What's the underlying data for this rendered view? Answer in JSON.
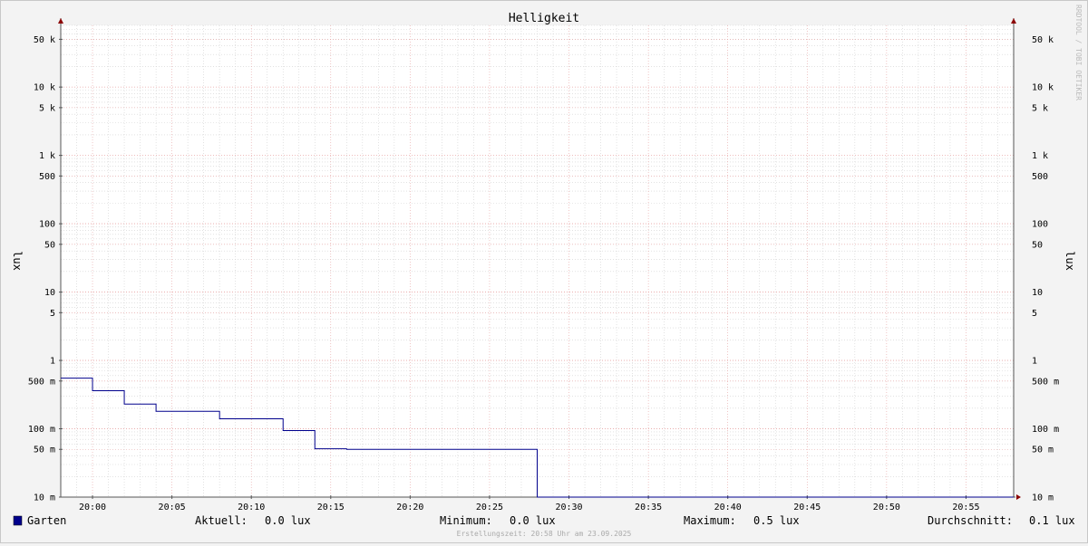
{
  "chart_data": {
    "type": "line",
    "title": "Helligkeit",
    "ylabel_left": "lux",
    "ylabel_right": "lux",
    "y_scale": "log",
    "ylim": [
      0.01,
      80000
    ],
    "y_ticks": [
      {
        "value": 50000,
        "label": "50 k"
      },
      {
        "value": 10000,
        "label": "10 k"
      },
      {
        "value": 5000,
        "label": "5 k"
      },
      {
        "value": 1000,
        "label": "1 k"
      },
      {
        "value": 500,
        "label": "500"
      },
      {
        "value": 100,
        "label": "100"
      },
      {
        "value": 50,
        "label": "50"
      },
      {
        "value": 10,
        "label": "10"
      },
      {
        "value": 5,
        "label": "5"
      },
      {
        "value": 1,
        "label": "1"
      },
      {
        "value": 0.5,
        "label": "500 m"
      },
      {
        "value": 0.1,
        "label": "100 m"
      },
      {
        "value": 0.05,
        "label": "50 m"
      },
      {
        "value": 0.01,
        "label": "10 m"
      }
    ],
    "x_range": [
      "19:58",
      "20:58"
    ],
    "x_ticks": [
      "20:00",
      "20:05",
      "20:10",
      "20:15",
      "20:20",
      "20:25",
      "20:30",
      "20:35",
      "20:40",
      "20:45",
      "20:50",
      "20:55"
    ],
    "series": [
      {
        "name": "Garten",
        "color": "#00008c",
        "points": [
          {
            "t": "19:58",
            "v": 0.55
          },
          {
            "t": "20:00",
            "v": 0.36
          },
          {
            "t": "20:02",
            "v": 0.23
          },
          {
            "t": "20:04",
            "v": 0.18
          },
          {
            "t": "20:08",
            "v": 0.14
          },
          {
            "t": "20:12",
            "v": 0.094
          },
          {
            "t": "20:14",
            "v": 0.051
          },
          {
            "t": "20:16",
            "v": 0.05
          },
          {
            "t": "20:28",
            "v": 0.01
          },
          {
            "t": "20:58",
            "v": 0.01
          }
        ]
      }
    ],
    "grid": true
  },
  "legend": {
    "series_name": "Garten",
    "series_color": "#00008c",
    "aktuell_label": "Aktuell:",
    "aktuell_value": "0.0 lux",
    "minimum_label": "Minimum:",
    "minimum_value": "0.0 lux",
    "maximum_label": "Maximum:",
    "maximum_value": "0.5 lux",
    "durchschnitt_label": "Durchschnitt:",
    "durchschnitt_value": "0.1 lux"
  },
  "footer": "Erstellungszeit: 20:58 Uhr am 23.09.2025",
  "watermark": "RRDTOOL / TOBI OETIKER",
  "colors": {
    "background": "#f3f3f3",
    "plot_background": "#ffffff",
    "major_grid": "#e6a0a0",
    "minor_grid": "#d0d0d0",
    "axis": "#555555",
    "arrow": "#8b0000"
  }
}
